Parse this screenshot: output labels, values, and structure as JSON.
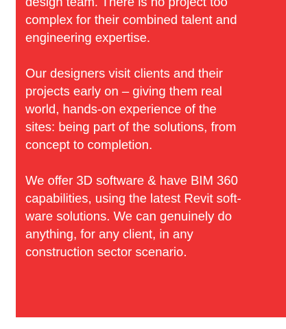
{
  "colors": {
    "panel_background": "#ee3233",
    "text": "#ffffff",
    "page_background": "#ffffff"
  },
  "paragraphs": [
    {
      "lines": [
        "design team. There is no project too",
        "complex for their combined talent and",
        "engineering expertise."
      ]
    },
    {
      "lines": [
        "Our designers visit clients and their",
        "projects early on – giving them real",
        "world, hands-on experience of the",
        "sites: being part of the solutions, from",
        "concept to completion."
      ]
    },
    {
      "lines": [
        "We offer 3D software & have BIM 360",
        "capabilities, using the latest Revit soft-",
        "ware solutions. We can genuinely do",
        "anything, for any client, in any",
        "construction sector scenario."
      ]
    }
  ]
}
